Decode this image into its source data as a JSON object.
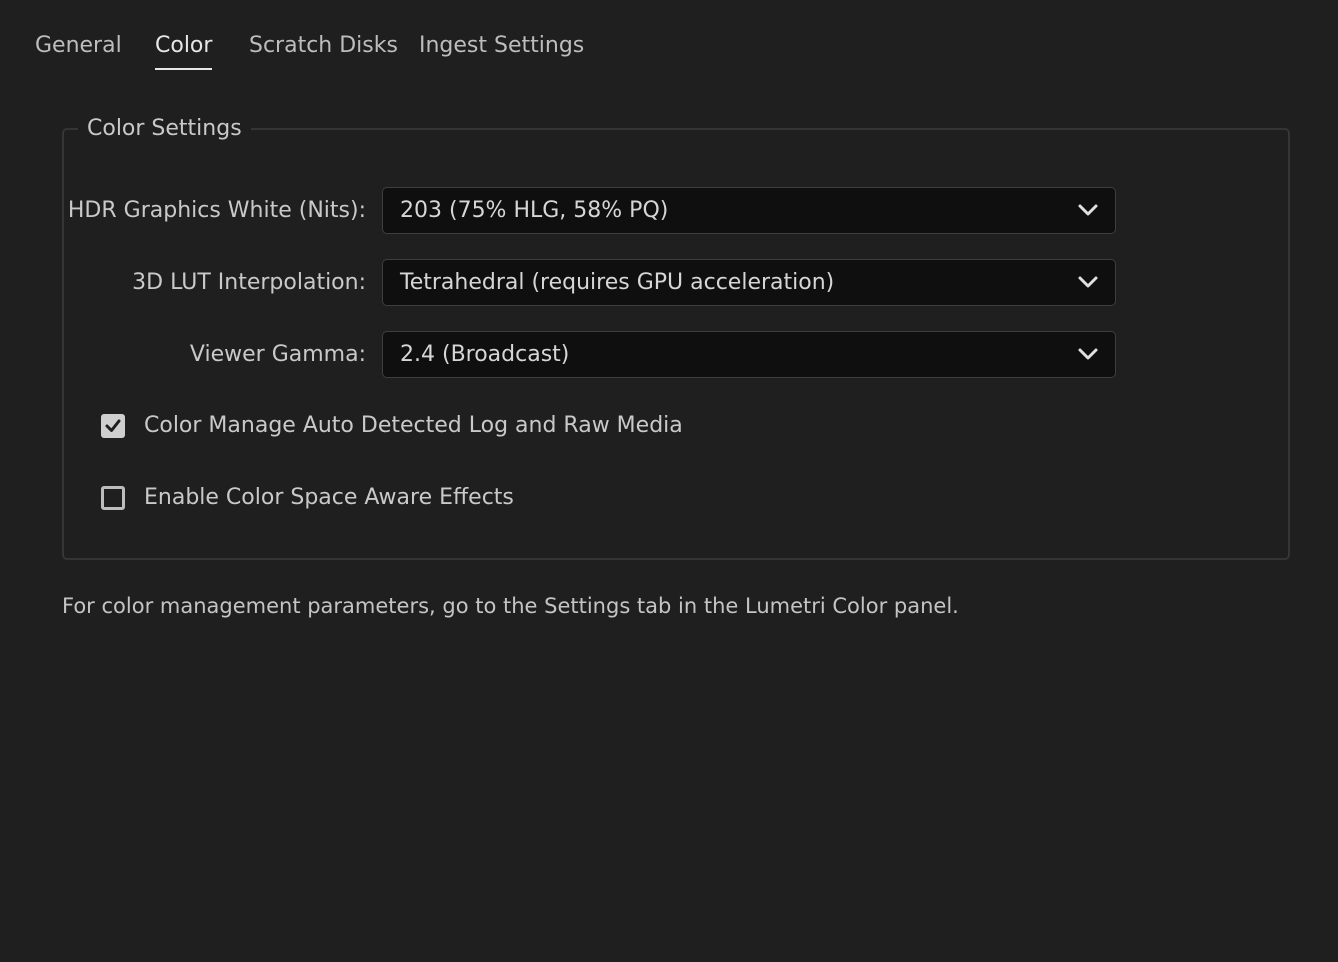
{
  "tabs": [
    {
      "label": "General",
      "active": false
    },
    {
      "label": "Color",
      "active": true
    },
    {
      "label": "Scratch Disks",
      "active": false
    },
    {
      "label": "Ingest Settings",
      "active": false
    }
  ],
  "color_settings": {
    "title": "Color Settings",
    "fields": [
      {
        "label": "HDR Graphics White (Nits):",
        "value": "203 (75% HLG, 58% PQ)",
        "icon": "chevron-down-icon"
      },
      {
        "label": "3D LUT Interpolation:",
        "value": "Tetrahedral (requires GPU acceleration)",
        "icon": "chevron-down-icon"
      },
      {
        "label": "Viewer Gamma:",
        "value": "2.4 (Broadcast)",
        "icon": "chevron-down-icon"
      }
    ],
    "checkboxes": [
      {
        "label": "Color Manage Auto Detected Log and Raw Media",
        "checked": true
      },
      {
        "label": "Enable Color Space Aware Effects",
        "checked": false
      }
    ]
  },
  "footnote": "For color management parameters, go to the Settings tab in the Lumetri Color panel.",
  "colors": {
    "background": "#1f1f1f",
    "dropdown_bg": "#0f0f0f",
    "text": "#c9c9c9",
    "active_tab": "#e6e6e6"
  }
}
